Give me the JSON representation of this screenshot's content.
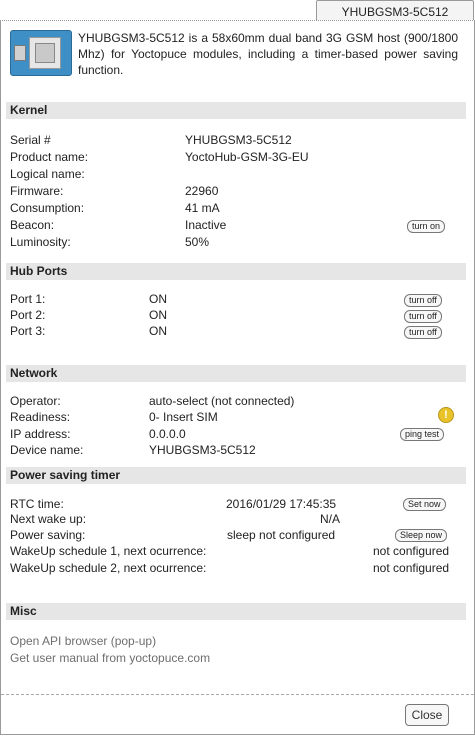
{
  "tab": {
    "title": "YHUBGSM3-5C512"
  },
  "intro": {
    "description": "YHUBGSM3-5C512 is a 58x60mm dual band 3G GSM host (900/1800 Mhz) for Yoctopuce modules, including a timer-based power saving function."
  },
  "kernel": {
    "header": "Kernel",
    "serial_label": "Serial #",
    "serial_value": "YHUBGSM3-5C512",
    "product_label": "Product name:",
    "product_value": "YoctoHub-GSM-3G-EU",
    "logical_label": "Logical name:",
    "logical_value": "",
    "firmware_label": "Firmware:",
    "firmware_value": "22960",
    "consumption_label": "Consumption:",
    "consumption_value": "41 mA",
    "beacon_label": "Beacon:",
    "beacon_value": "Inactive",
    "beacon_button": "turn on",
    "luminosity_label": "Luminosity:",
    "luminosity_value": "50%"
  },
  "hub_ports": {
    "header": "Hub Ports",
    "ports": [
      {
        "label": "Port 1:",
        "value": "ON",
        "button": "turn off"
      },
      {
        "label": "Port 2:",
        "value": "ON",
        "button": "turn off"
      },
      {
        "label": "Port 3:",
        "value": "ON",
        "button": "turn off"
      }
    ]
  },
  "network": {
    "header": "Network",
    "operator_label": "Operator:",
    "operator_value": "auto-select (not connected)",
    "readiness_label": "Readiness:",
    "readiness_value": "0- Insert SIM",
    "warning_symbol": "!",
    "ip_label": "IP address:",
    "ip_value": "0.0.0.0",
    "ping_button": "ping test",
    "device_label": "Device name:",
    "device_value": "YHUBGSM3-5C512"
  },
  "power": {
    "header": "Power saving timer",
    "rtc_label": "RTC time:",
    "rtc_value": "2016/01/29 17:45:35",
    "rtc_button": "Set now",
    "wake_label": "Next wake up:",
    "wake_value": "N/A",
    "saving_label": "Power saving:",
    "saving_value": "sleep not configured",
    "sleep_button": "Sleep now",
    "sched1_label": "WakeUp schedule 1, next ocurrence:",
    "sched1_value": "not configured",
    "sched2_label": "WakeUp schedule 2, next ocurrence:",
    "sched2_value": "not configured"
  },
  "misc": {
    "header": "Misc",
    "api_link": "Open API browser (pop-up)",
    "manual_link": "Get user manual from yoctopuce.com"
  },
  "footer": {
    "close_button": "Close"
  },
  "icons": {
    "device": "device-board-icon",
    "warning": "warning-icon"
  },
  "colors": {
    "section_bg": "#e6e6e6",
    "warning": "#e8c32a",
    "link": "#6e6e6e"
  }
}
